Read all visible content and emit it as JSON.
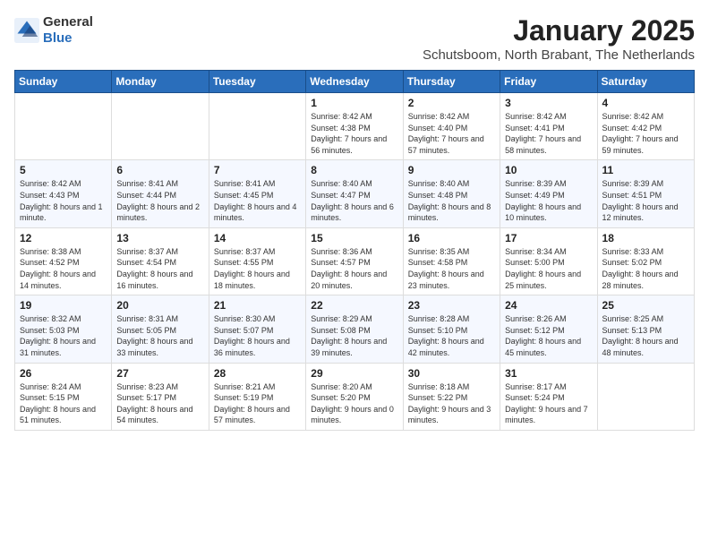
{
  "header": {
    "logo_general": "General",
    "logo_blue": "Blue",
    "month": "January 2025",
    "location": "Schutsboom, North Brabant, The Netherlands"
  },
  "days_of_week": [
    "Sunday",
    "Monday",
    "Tuesday",
    "Wednesday",
    "Thursday",
    "Friday",
    "Saturday"
  ],
  "weeks": [
    [
      {
        "day": "",
        "info": ""
      },
      {
        "day": "",
        "info": ""
      },
      {
        "day": "",
        "info": ""
      },
      {
        "day": "1",
        "info": "Sunrise: 8:42 AM\nSunset: 4:38 PM\nDaylight: 7 hours and 56 minutes."
      },
      {
        "day": "2",
        "info": "Sunrise: 8:42 AM\nSunset: 4:40 PM\nDaylight: 7 hours and 57 minutes."
      },
      {
        "day": "3",
        "info": "Sunrise: 8:42 AM\nSunset: 4:41 PM\nDaylight: 7 hours and 58 minutes."
      },
      {
        "day": "4",
        "info": "Sunrise: 8:42 AM\nSunset: 4:42 PM\nDaylight: 7 hours and 59 minutes."
      }
    ],
    [
      {
        "day": "5",
        "info": "Sunrise: 8:42 AM\nSunset: 4:43 PM\nDaylight: 8 hours and 1 minute."
      },
      {
        "day": "6",
        "info": "Sunrise: 8:41 AM\nSunset: 4:44 PM\nDaylight: 8 hours and 2 minutes."
      },
      {
        "day": "7",
        "info": "Sunrise: 8:41 AM\nSunset: 4:45 PM\nDaylight: 8 hours and 4 minutes."
      },
      {
        "day": "8",
        "info": "Sunrise: 8:40 AM\nSunset: 4:47 PM\nDaylight: 8 hours and 6 minutes."
      },
      {
        "day": "9",
        "info": "Sunrise: 8:40 AM\nSunset: 4:48 PM\nDaylight: 8 hours and 8 minutes."
      },
      {
        "day": "10",
        "info": "Sunrise: 8:39 AM\nSunset: 4:49 PM\nDaylight: 8 hours and 10 minutes."
      },
      {
        "day": "11",
        "info": "Sunrise: 8:39 AM\nSunset: 4:51 PM\nDaylight: 8 hours and 12 minutes."
      }
    ],
    [
      {
        "day": "12",
        "info": "Sunrise: 8:38 AM\nSunset: 4:52 PM\nDaylight: 8 hours and 14 minutes."
      },
      {
        "day": "13",
        "info": "Sunrise: 8:37 AM\nSunset: 4:54 PM\nDaylight: 8 hours and 16 minutes."
      },
      {
        "day": "14",
        "info": "Sunrise: 8:37 AM\nSunset: 4:55 PM\nDaylight: 8 hours and 18 minutes."
      },
      {
        "day": "15",
        "info": "Sunrise: 8:36 AM\nSunset: 4:57 PM\nDaylight: 8 hours and 20 minutes."
      },
      {
        "day": "16",
        "info": "Sunrise: 8:35 AM\nSunset: 4:58 PM\nDaylight: 8 hours and 23 minutes."
      },
      {
        "day": "17",
        "info": "Sunrise: 8:34 AM\nSunset: 5:00 PM\nDaylight: 8 hours and 25 minutes."
      },
      {
        "day": "18",
        "info": "Sunrise: 8:33 AM\nSunset: 5:02 PM\nDaylight: 8 hours and 28 minutes."
      }
    ],
    [
      {
        "day": "19",
        "info": "Sunrise: 8:32 AM\nSunset: 5:03 PM\nDaylight: 8 hours and 31 minutes."
      },
      {
        "day": "20",
        "info": "Sunrise: 8:31 AM\nSunset: 5:05 PM\nDaylight: 8 hours and 33 minutes."
      },
      {
        "day": "21",
        "info": "Sunrise: 8:30 AM\nSunset: 5:07 PM\nDaylight: 8 hours and 36 minutes."
      },
      {
        "day": "22",
        "info": "Sunrise: 8:29 AM\nSunset: 5:08 PM\nDaylight: 8 hours and 39 minutes."
      },
      {
        "day": "23",
        "info": "Sunrise: 8:28 AM\nSunset: 5:10 PM\nDaylight: 8 hours and 42 minutes."
      },
      {
        "day": "24",
        "info": "Sunrise: 8:26 AM\nSunset: 5:12 PM\nDaylight: 8 hours and 45 minutes."
      },
      {
        "day": "25",
        "info": "Sunrise: 8:25 AM\nSunset: 5:13 PM\nDaylight: 8 hours and 48 minutes."
      }
    ],
    [
      {
        "day": "26",
        "info": "Sunrise: 8:24 AM\nSunset: 5:15 PM\nDaylight: 8 hours and 51 minutes."
      },
      {
        "day": "27",
        "info": "Sunrise: 8:23 AM\nSunset: 5:17 PM\nDaylight: 8 hours and 54 minutes."
      },
      {
        "day": "28",
        "info": "Sunrise: 8:21 AM\nSunset: 5:19 PM\nDaylight: 8 hours and 57 minutes."
      },
      {
        "day": "29",
        "info": "Sunrise: 8:20 AM\nSunset: 5:20 PM\nDaylight: 9 hours and 0 minutes."
      },
      {
        "day": "30",
        "info": "Sunrise: 8:18 AM\nSunset: 5:22 PM\nDaylight: 9 hours and 3 minutes."
      },
      {
        "day": "31",
        "info": "Sunrise: 8:17 AM\nSunset: 5:24 PM\nDaylight: 9 hours and 7 minutes."
      },
      {
        "day": "",
        "info": ""
      }
    ]
  ]
}
